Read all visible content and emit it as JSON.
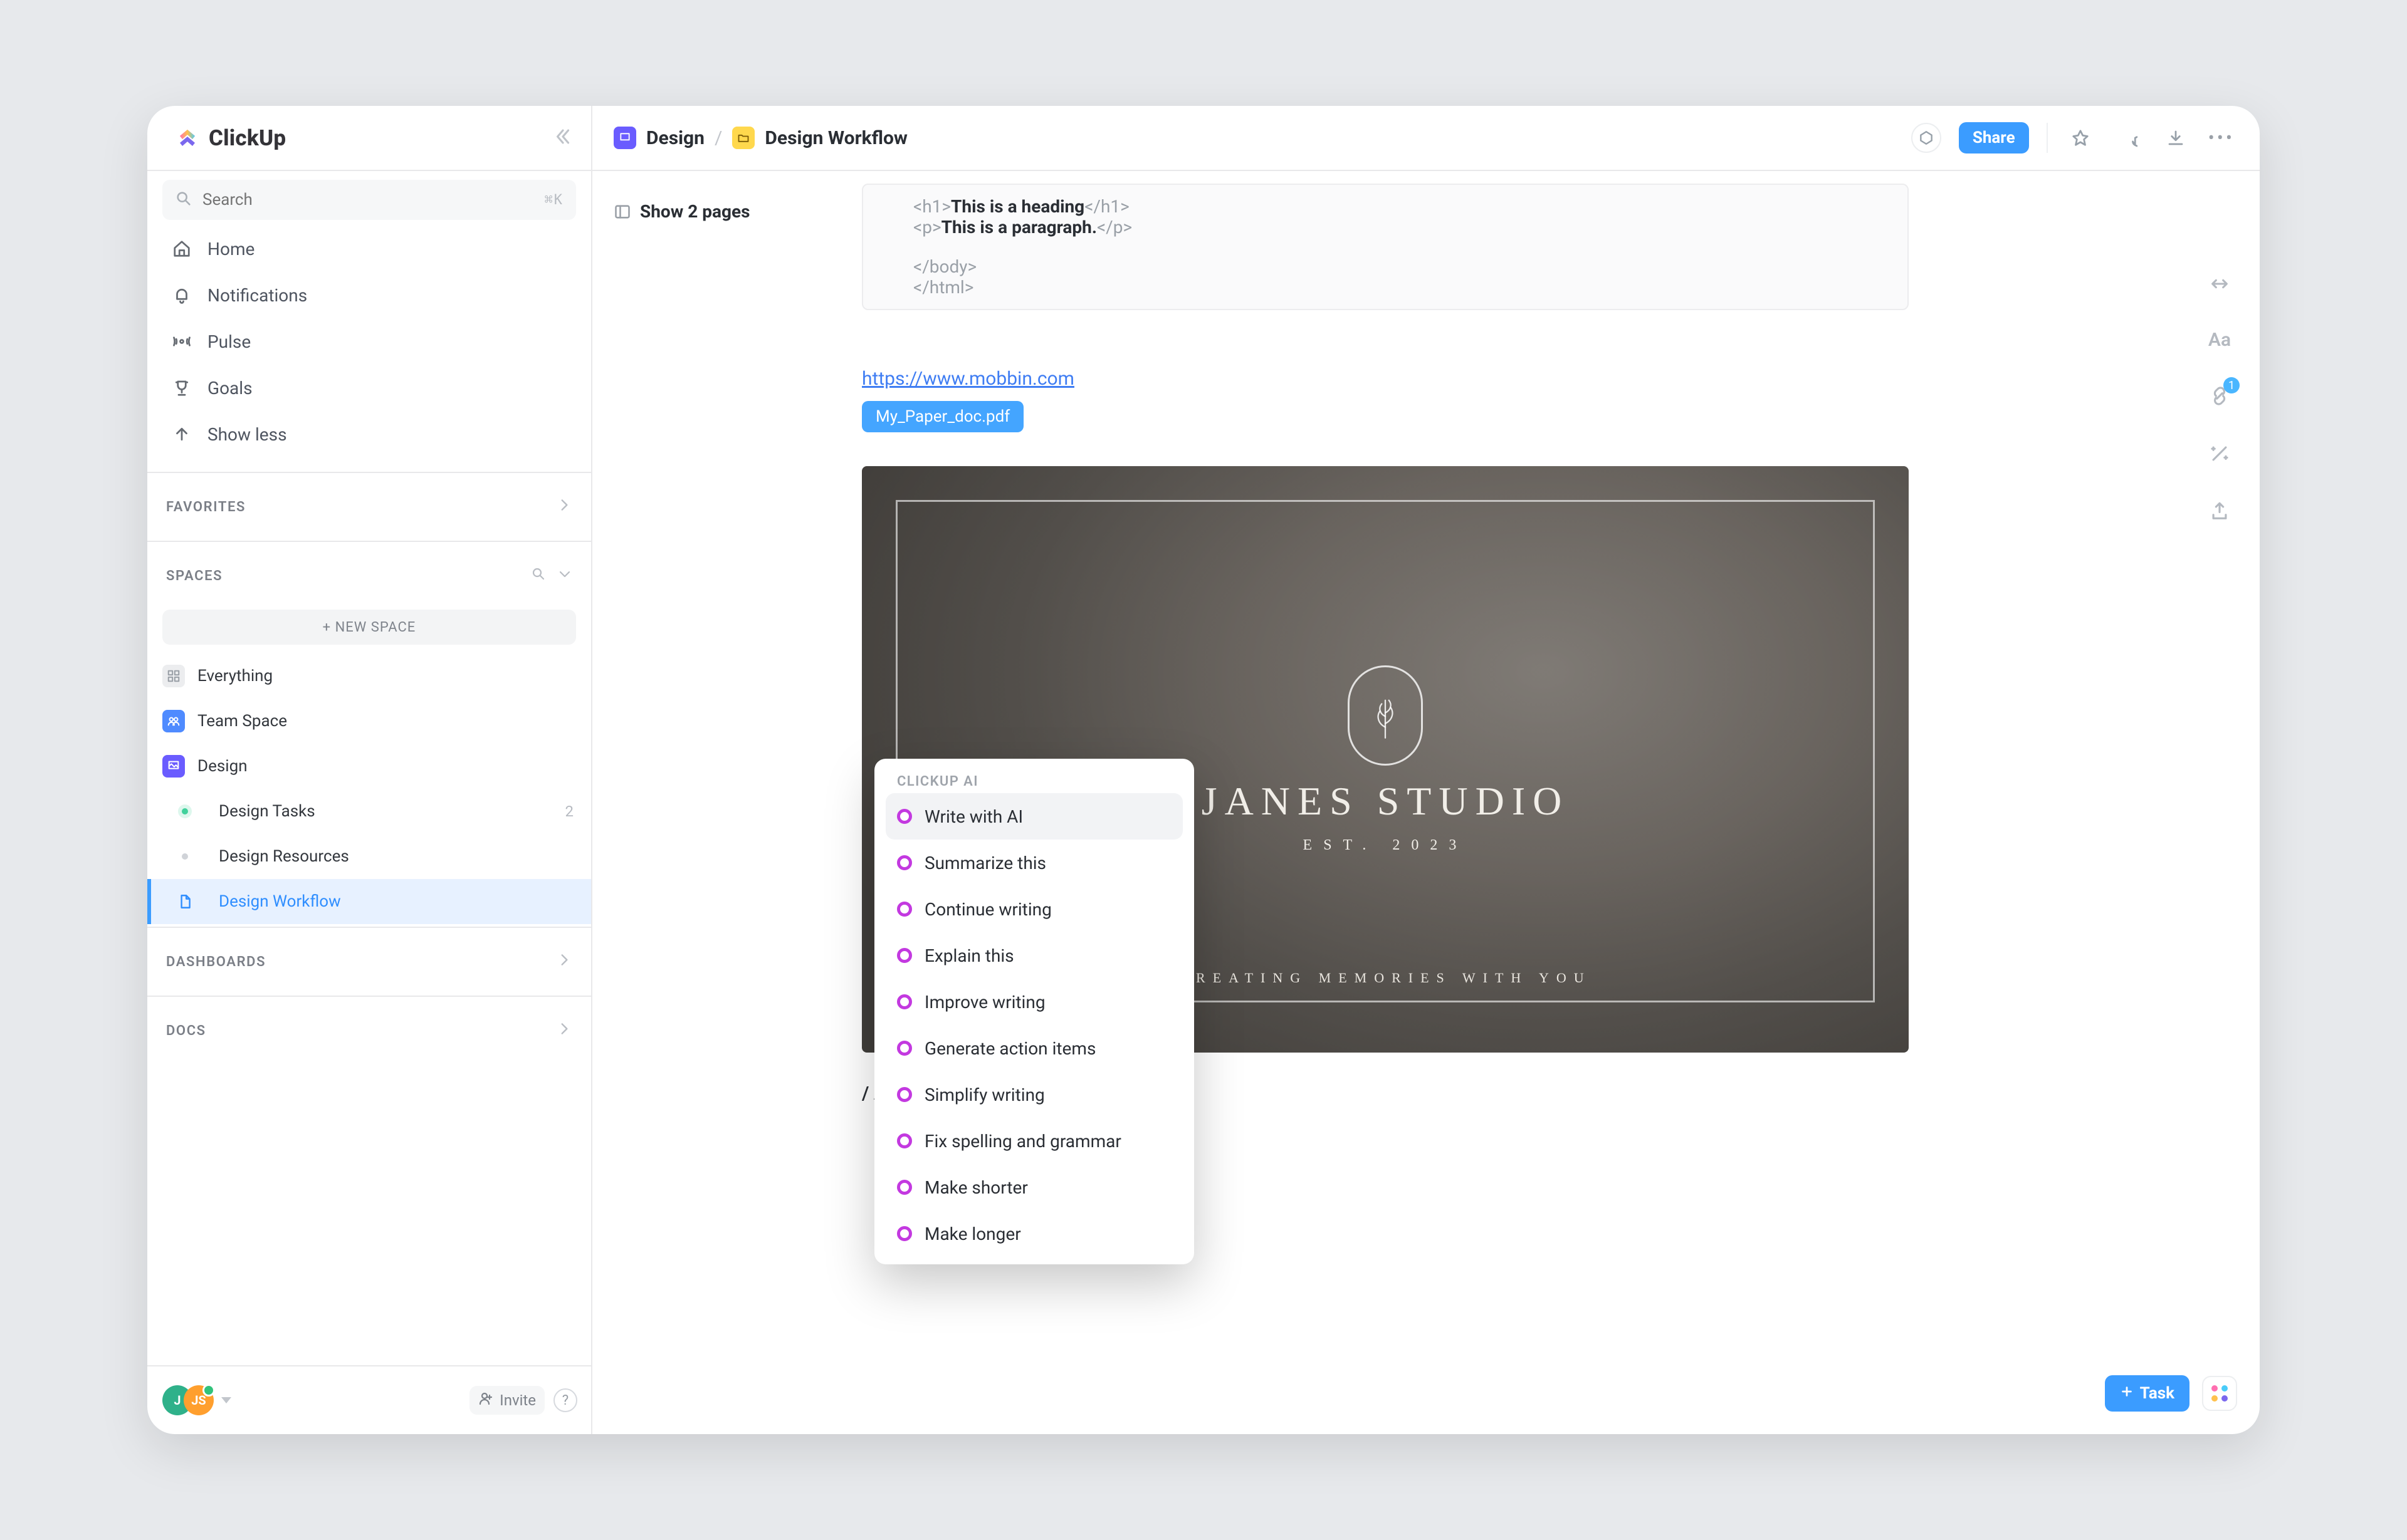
{
  "brand": "ClickUp",
  "search": {
    "placeholder": "Search",
    "kbd": "⌘K"
  },
  "nav": [
    {
      "label": "Home"
    },
    {
      "label": "Notifications"
    },
    {
      "label": "Pulse"
    },
    {
      "label": "Goals"
    },
    {
      "label": "Show less"
    }
  ],
  "sections": {
    "favorites": "FAVORITES",
    "spaces": "SPACES",
    "dashboards": "DASHBOARDS",
    "docs": "DOCS"
  },
  "new_space": "+ NEW SPACE",
  "tree": {
    "everything": "Everything",
    "team_space": "Team Space",
    "design": "Design",
    "children": [
      {
        "label": "Design Tasks",
        "count": "2"
      },
      {
        "label": "Design Resources"
      },
      {
        "label": "Design Workflow"
      }
    ]
  },
  "footer": {
    "avatar1": "J",
    "avatar2": "JS",
    "invite": "Invite"
  },
  "breadcrumb": {
    "a": "Design",
    "b": "Design Workflow"
  },
  "topbar": {
    "share": "Share"
  },
  "pages_toggle": "Show 2 pages",
  "code": {
    "l1a": "<h1>",
    "l1b": "This is a heading",
    "l1c": "</h1>",
    "l2a": "<p>",
    "l2b": "This is a paragraph.",
    "l2c": "</p>",
    "l3": "</body>",
    "l4": "</html>"
  },
  "link": "https://www.mobbin.com",
  "chip": "My_Paper_doc.pdf",
  "hero": {
    "title": "JANES STUDIO",
    "sub": "EST. 2023",
    "caption": "CREATING MEMORIES WITH YOU"
  },
  "slash": "/ AI",
  "ai": {
    "heading": "CLICKUP AI",
    "items": [
      "Write with AI",
      "Summarize this",
      "Continue writing",
      "Explain this",
      "Improve writing",
      "Generate action items",
      "Simplify writing",
      "Fix spelling and grammar",
      "Make shorter",
      "Make longer"
    ]
  },
  "rail": {
    "badge": "1"
  },
  "task_btn": "Task"
}
